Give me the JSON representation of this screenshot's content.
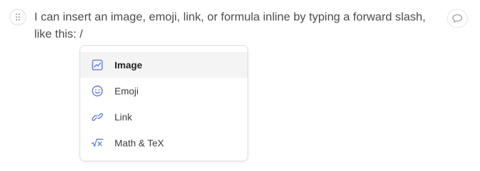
{
  "editor": {
    "paragraph_text": "I can insert an image, emoji, link, or formula inline by typing a forward slash, like this: /"
  },
  "slash_menu": {
    "items": [
      {
        "label": "Image",
        "icon": "image-icon",
        "active": true
      },
      {
        "label": "Emoji",
        "icon": "emoji-icon",
        "active": false
      },
      {
        "label": "Link",
        "icon": "link-icon",
        "active": false
      },
      {
        "label": "Math & TeX",
        "icon": "math-icon",
        "active": false
      }
    ]
  },
  "colors": {
    "icon_blue": "#4a6fd6",
    "active_row_bg": "#f4f4f5",
    "text": "#4d4d4d"
  }
}
